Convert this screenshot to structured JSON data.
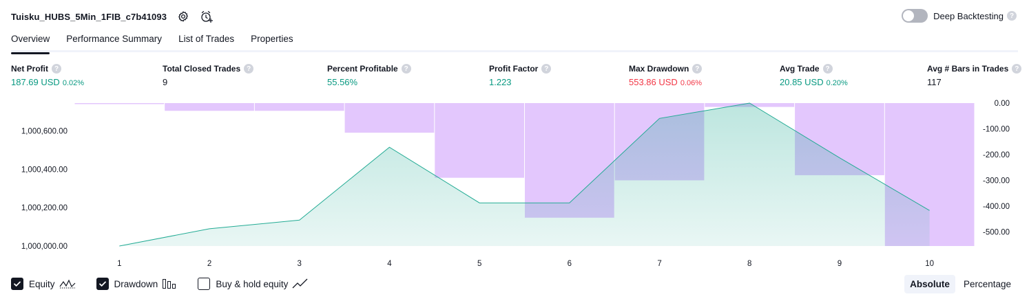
{
  "header": {
    "title": "Tuisku_HUBS_5Min_1FIB_c7b41093",
    "deep_backtesting_label": "Deep Backtesting",
    "help_glyph": "?"
  },
  "tabs": [
    {
      "label": "Overview",
      "active": true
    },
    {
      "label": "Performance Summary",
      "active": false
    },
    {
      "label": "List of Trades",
      "active": false
    },
    {
      "label": "Properties",
      "active": false
    }
  ],
  "stats": [
    {
      "label": "Net Profit",
      "value": "187.69 USD",
      "pct": "0.02%",
      "color": "green"
    },
    {
      "label": "Total Closed Trades",
      "value": "9",
      "pct": "",
      "color": "dark"
    },
    {
      "label": "Percent Profitable",
      "value": "55.56%",
      "pct": "",
      "color": "green"
    },
    {
      "label": "Profit Factor",
      "value": "1.223",
      "pct": "",
      "color": "green"
    },
    {
      "label": "Max Drawdown",
      "value": "553.86 USD",
      "pct": "0.06%",
      "color": "red"
    },
    {
      "label": "Avg Trade",
      "value": "20.85 USD",
      "pct": "0.20%",
      "color": "green"
    },
    {
      "label": "Avg # Bars in Trades",
      "value": "117",
      "pct": "",
      "color": "dark"
    }
  ],
  "chart_data": {
    "type": "line",
    "x": [
      1,
      2,
      3,
      4,
      5,
      6,
      7,
      8,
      9,
      10
    ],
    "x_tick_labels": [
      "1",
      "2",
      "3",
      "4",
      "5",
      "6",
      "7",
      "8",
      "9",
      "10"
    ],
    "left_axis": {
      "ticks": [
        1000000,
        1000200,
        1000400,
        1000600
      ],
      "tick_labels": [
        "1,000,000.00",
        "1,000,200.00",
        "1,000,400.00",
        "1,000,600.00"
      ],
      "ylim": [
        1000000,
        1000745
      ]
    },
    "right_axis": {
      "ticks": [
        0,
        -100,
        -200,
        -300,
        -400,
        -500
      ],
      "tick_labels": [
        "0.00",
        "-100.00",
        "-200.00",
        "-300.00",
        "-400.00",
        "-500.00"
      ],
      "ylim": [
        -555,
        0
      ]
    },
    "series": [
      {
        "name": "Equity",
        "type": "area",
        "axis": "left",
        "color": "#22ab94",
        "values": [
          1000000,
          1000090,
          1000135,
          1000515,
          1000225,
          1000225,
          1000665,
          1000745,
          1000460,
          1000185
        ]
      },
      {
        "name": "Drawdown",
        "type": "bar",
        "axis": "right",
        "color": "#e1c4fd",
        "values": [
          0,
          -30,
          -30,
          -115,
          -290,
          -445,
          -300,
          -15,
          -280,
          -555
        ]
      }
    ],
    "legend": [
      {
        "label": "Equity",
        "checked": true,
        "icon": "equity-line-icon"
      },
      {
        "label": "Drawdown",
        "checked": true,
        "icon": "drawdown-bars-icon"
      },
      {
        "label": "Buy & hold equity",
        "checked": false,
        "icon": "buy-hold-line-icon"
      }
    ]
  },
  "modes": {
    "absolute_label": "Absolute",
    "percentage_label": "Percentage",
    "selected": "Absolute"
  },
  "colors": {
    "positive": "#089981",
    "negative": "#f23645",
    "equity_line": "#22ab94",
    "drawdown_fill": "#e1c4fd"
  }
}
